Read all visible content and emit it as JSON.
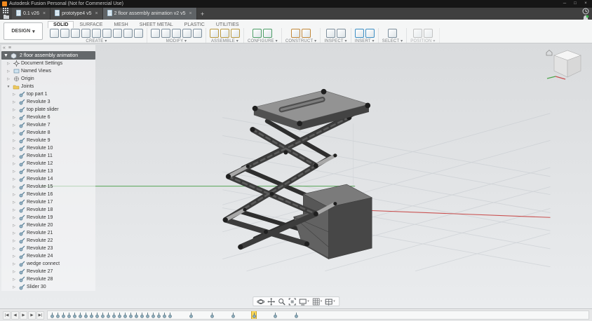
{
  "glyphs": {
    "caret_down": "▾",
    "tree_collapsed": "▷",
    "tree_expanded": "▼",
    "close": "×",
    "new_tab": "+",
    "window_min": "─",
    "window_max": "□",
    "window_close": "×"
  },
  "titlebar": {
    "title": "Autodesk Fusion Personal (Not for Commercial Use)"
  },
  "tabbar": {
    "tabs": [
      {
        "label": "0.1 v26",
        "active": false
      },
      {
        "label": "prototype4 v5",
        "active": false
      },
      {
        "label": "2 floor assembly animation v2 v5",
        "active": true
      }
    ],
    "left_icons": [
      "data-panel-grid",
      "file-folder"
    ],
    "right_icons": [
      "job-status",
      "notifications",
      "help",
      "profile"
    ]
  },
  "toolbar": {
    "workspace_label": "DESIGN",
    "ribbon_tabs": [
      {
        "label": "SOLID",
        "active": true
      },
      {
        "label": "SURFACE",
        "active": false
      },
      {
        "label": "MESH",
        "active": false
      },
      {
        "label": "SHEET METAL",
        "active": false
      },
      {
        "label": "PLASTIC",
        "active": false
      },
      {
        "label": "UTILITIES",
        "active": false
      }
    ],
    "groups": [
      {
        "label": "CREATE",
        "icons": 9,
        "accent": "#7e8f9c",
        "disabled": false
      },
      {
        "label": "MODIFY",
        "icons": 5,
        "accent": "#7e8f9c",
        "disabled": false
      },
      {
        "label": "ASSEMBLE",
        "icons": 3,
        "accent": "#b99941",
        "disabled": false
      },
      {
        "label": "CONFIGURE",
        "icons": 2,
        "accent": "#4d9e67",
        "disabled": false
      },
      {
        "label": "CONSTRUCT",
        "icons": 2,
        "accent": "#c2883a",
        "disabled": false
      },
      {
        "label": "INSPECT",
        "icons": 2,
        "accent": "#7e8f9c",
        "disabled": false
      },
      {
        "label": "INSERT",
        "icons": 2,
        "accent": "#3e8fc4",
        "disabled": false
      },
      {
        "label": "SELECT",
        "icons": 1,
        "accent": "#7e8f9c",
        "disabled": false
      },
      {
        "label": "POSITION",
        "icons": 2,
        "accent": "#9a9a9a",
        "disabled": true
      }
    ]
  },
  "browser": {
    "root_label": "2 floor assembly animation",
    "sections": [
      {
        "label": "Document Settings",
        "icon": "settings",
        "expanded": false
      },
      {
        "label": "Named Views",
        "icon": "views",
        "expanded": false
      },
      {
        "label": "Origin",
        "icon": "origin",
        "expanded": false
      },
      {
        "label": "Joints",
        "icon": "folder",
        "expanded": true
      }
    ],
    "joints": [
      "top part 1",
      "Revolute 3",
      "top plate slider",
      "Revolute 6",
      "Revolute 7",
      "Revolute 8",
      "Revolute 9",
      "Revolute 10",
      "Revolute 11",
      "Revolute 12",
      "Revolute 13",
      "Revolute 14",
      "Revolute 15",
      "Revolute 16",
      "Revolute 17",
      "Revolute 18",
      "Revolute 19",
      "Revolute 20",
      "Revolute 21",
      "Revolute 22",
      "Revolute 23",
      "Revolute 24",
      "wedge connect",
      "Revolute 27",
      "Revolute 28",
      "Slider 30"
    ]
  },
  "viewport": {
    "axis_x_color": "#c94f4f",
    "axis_z_color": "#55a455",
    "grid_color": "#c2c7cc",
    "model_dark": "#3c3c3c",
    "model_mid": "#626262",
    "model_light": "#939393",
    "cylinder_color": "#a8a8a8"
  },
  "navbar": {
    "items": [
      {
        "name": "orbit",
        "caret": false
      },
      {
        "name": "pan",
        "caret": false
      },
      {
        "name": "zoom",
        "caret": false
      },
      {
        "name": "fit",
        "caret": false
      },
      {
        "name": "display-settings",
        "caret": true
      },
      {
        "name": "grid-settings",
        "caret": true
      },
      {
        "name": "viewports",
        "caret": true
      }
    ]
  },
  "timeline": {
    "playback": [
      {
        "name": "go-to-start",
        "glyph": "|◀"
      },
      {
        "name": "step-back",
        "glyph": "◀"
      },
      {
        "name": "play",
        "glyph": "▶"
      },
      {
        "name": "step-forward",
        "glyph": "▶"
      },
      {
        "name": "go-to-end",
        "glyph": "▶|"
      }
    ],
    "marker_count": 28,
    "highlighted_index": 25,
    "spaced_from": 22,
    "marker_color": "#8fb0bf",
    "highlight_color": "#ffd957"
  }
}
